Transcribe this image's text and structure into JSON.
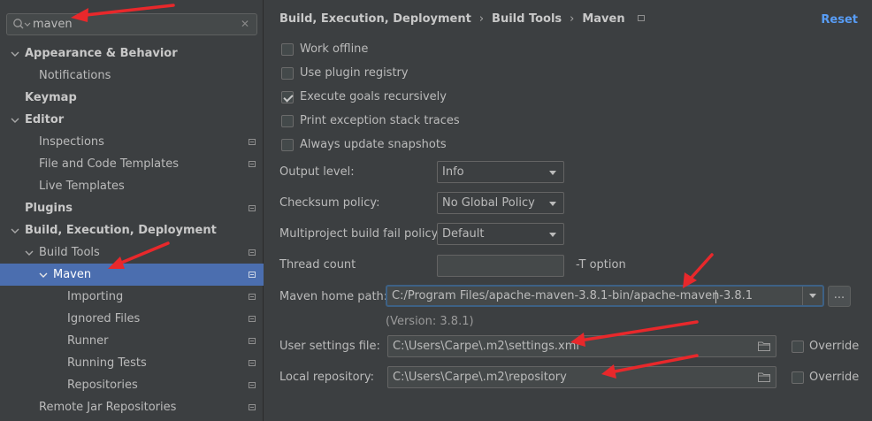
{
  "sidebar": {
    "search": {
      "value": "maven"
    },
    "items": [
      {
        "label": "Appearance & Behavior",
        "bold": true,
        "expanded": true
      },
      {
        "label": "Notifications"
      },
      {
        "label": "Keymap",
        "bold": true
      },
      {
        "label": "Editor",
        "bold": true,
        "expanded": true
      },
      {
        "label": "Inspections"
      },
      {
        "label": "File and Code Templates"
      },
      {
        "label": "Live Templates"
      },
      {
        "label": "Plugins",
        "bold": true
      },
      {
        "label": "Build, Execution, Deployment",
        "bold": true,
        "expanded": true
      },
      {
        "label": "Build Tools",
        "expanded": true
      },
      {
        "label": "Maven",
        "expanded": true,
        "selected": true
      },
      {
        "label": "Importing"
      },
      {
        "label": "Ignored Files"
      },
      {
        "label": "Runner"
      },
      {
        "label": "Running Tests"
      },
      {
        "label": "Repositories"
      },
      {
        "label": "Remote Jar Repositories"
      }
    ]
  },
  "header": {
    "breadcrumbs": [
      "Build, Execution, Deployment",
      "Build Tools",
      "Maven"
    ],
    "separator": "›",
    "reset_label": "Reset"
  },
  "options": {
    "work_offline": {
      "label": "Work offline",
      "checked": false
    },
    "use_plugin_registry": {
      "label": "Use plugin registry",
      "checked": false
    },
    "execute_goals_recursively": {
      "label": "Execute goals recursively",
      "checked": true
    },
    "print_exception_stack_traces": {
      "label": "Print exception stack traces",
      "checked": false
    },
    "always_update_snapshots": {
      "label": "Always update snapshots",
      "checked": false
    }
  },
  "fields": {
    "output_level": {
      "label": "Output level:",
      "value": "Info"
    },
    "checksum_policy": {
      "label": "Checksum policy:",
      "value": "No Global Policy"
    },
    "multiproject_fail_policy": {
      "label": "Multiproject build fail policy:",
      "value": "Default"
    },
    "thread_count": {
      "label": "Thread count",
      "value": "",
      "suffix": "-T option"
    },
    "maven_home_path": {
      "label": "Maven home path:",
      "value": "C:/Program Files/apache-maven-3.8.1-bin/apache-maven-3.8.1",
      "browse_label": "...",
      "version": "(Version: 3.8.1)"
    },
    "user_settings_file": {
      "label": "User settings file:",
      "value": "C:\\Users\\Carpe\\.m2\\settings.xml",
      "override_label": "Override",
      "override_checked": false
    },
    "local_repository": {
      "label": "Local repository:",
      "value": "C:\\Users\\Carpe\\.m2\\repository",
      "override_label": "Override",
      "override_checked": false
    }
  },
  "colors": {
    "background": "#3c3f41",
    "selection": "#4b6eaf",
    "link": "#589df6",
    "annotation_arrow": "#e8282b"
  }
}
